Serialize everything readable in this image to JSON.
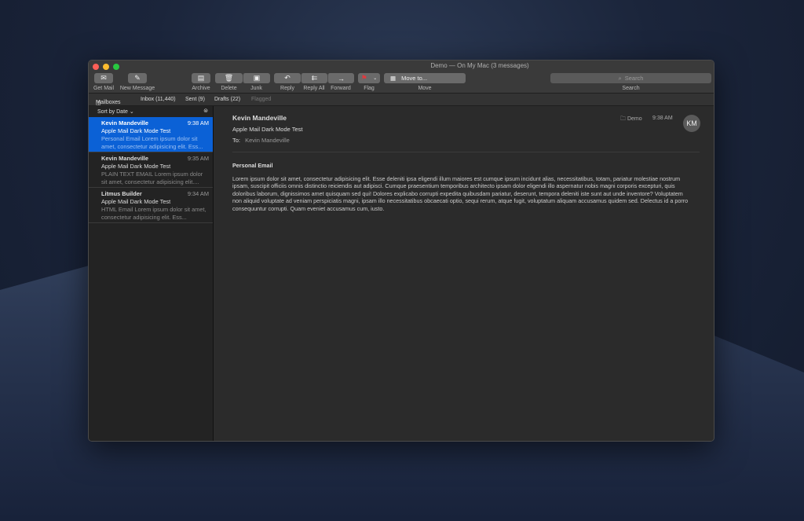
{
  "window": {
    "title": "Demo — On My Mac (3 messages)"
  },
  "toolbar": {
    "get_mail": "Get Mail",
    "new_message": "New Message",
    "archive": "Archive",
    "delete": "Delete",
    "junk": "Junk",
    "reply": "Reply",
    "reply_all": "Reply All",
    "forward": "Forward",
    "flag": "Flag",
    "move_to": "Move to...",
    "move": "Move",
    "search_placeholder": "Search",
    "search_label": "Search"
  },
  "favorites": {
    "mailboxes": "Mailboxes",
    "inbox": "Inbox (11,440)",
    "sent": "Sent (9)",
    "drafts": "Drafts (22)",
    "flagged": "Flagged"
  },
  "list": {
    "sort": "Sort by Date",
    "messages": [
      {
        "from": "Kevin Mandeville",
        "time": "9:38 AM",
        "subject": "Apple Mail Dark Mode Test",
        "preview": "Personal Email Lorem ipsum dolor sit amet, consectetur adipisicing elit. Ess..."
      },
      {
        "from": "Kevin Mandeville",
        "time": "9:35 AM",
        "subject": "Apple Mail Dark Mode Test",
        "preview": "PLAIN TEXT EMAIL Lorem ipsum dolor sit amet, consectetur adipisicing elit...."
      },
      {
        "from": "Litmus Builder",
        "time": "9:34 AM",
        "subject": "Apple Mail Dark Mode Test",
        "preview": "HTML Email Lorem ipsum dolor sit amet, consectetur adipisicing elit. Ess..."
      }
    ]
  },
  "message": {
    "from": "Kevin Mandeville",
    "subject": "Apple Mail Dark Mode Test",
    "to_label": "To:",
    "to": "Kevin Mandeville",
    "mailbox": "Demo",
    "time": "9:38 AM",
    "avatar": "KM",
    "heading": "Personal Email",
    "body": "Lorem ipsum dolor sit amet, consectetur adipisicing elit. Esse deleniti ipsa eligendi illum maiores est cumque ipsum incidunt alias, necessitatibus, totam, pariatur molestiae nostrum ipsam, suscipit officiis omnis distinctio reiciendis aut adipisci. Cumque praesentium temporibus architecto ipsam dolor eligendi illo aspernatur nobis magni corporis excepturi, quis doloribus laborum, dignissimos amet quisquam sed qui! Dolores explicabo corrupti expedita quibusdam pariatur, deserunt, tempora deleniti iste sunt aut unde inventore? Voluptatem non aliquid voluptate ad veniam perspiciatis magni, ipsam illo necessitatibus obcaecati optio, sequi rerum, atque fugit, voluptatum aliquam accusamus quidem sed. Delectus id a porro consequuntur corrupti. Quam eveniet accusamus cum, iusto."
  }
}
